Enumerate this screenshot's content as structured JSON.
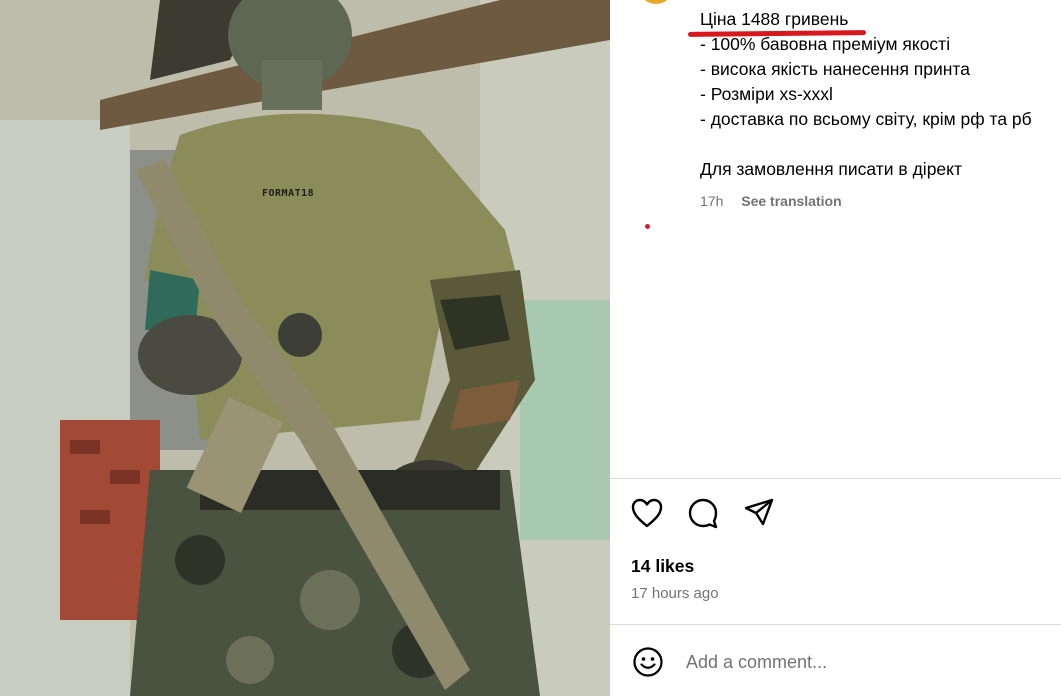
{
  "photo": {
    "alt": "soldier-in-olive-tshirt-with-rifle",
    "shirt_logo": "FORMAT18"
  },
  "caption": {
    "lines": [
      "Ціна 1488 гривень",
      "- 100% бавовна преміум якості",
      "- висока якість нанесення принта",
      "- Розміри xs-xxxl",
      "- доставка по всьому світу, крім рф та рб",
      "Для замовлення писати в дірект"
    ],
    "highlight_color": "#d7181f"
  },
  "meta": {
    "time": "17h",
    "see_translation": "See translation"
  },
  "actions": {
    "like_icon": "heart-icon",
    "comment_icon": "comment-icon",
    "share_icon": "share-icon"
  },
  "post": {
    "likes": "14 likes",
    "posted_ago": "17 hours ago"
  },
  "comment": {
    "placeholder": "Add a comment...",
    "emoji_icon": "emoji-icon"
  },
  "colors": {
    "secondary_text": "#737373",
    "divider": "#dbdbdb",
    "notification_dot": "#e0173b"
  }
}
